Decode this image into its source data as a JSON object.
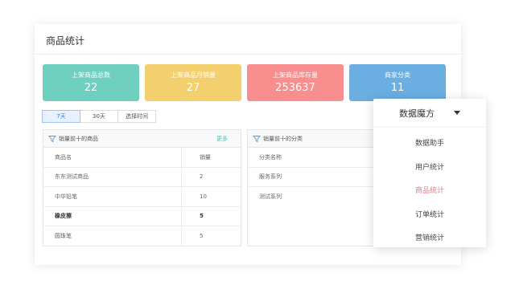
{
  "card": {
    "title": "商品统计"
  },
  "stats": [
    {
      "label": "上架商品总数",
      "value": "22",
      "color": "#6fd0c0"
    },
    {
      "label": "上架商品月销量",
      "value": "27",
      "color": "#f4cf6e"
    },
    {
      "label": "上架商品库存量",
      "value": "253637",
      "color": "#f88e8d"
    },
    {
      "label": "商家分类",
      "value": "11",
      "color": "#6aaee2"
    }
  ],
  "tabs": [
    "7天",
    "30天",
    "选择时间"
  ],
  "left_panel": {
    "title": "销量前十的商品",
    "more": "更多",
    "columns": [
      "商品名",
      "销量"
    ],
    "rows": [
      [
        "东东测试商品",
        "2"
      ],
      [
        "中华铅笔",
        "10"
      ],
      [
        "橡皮擦",
        "5"
      ],
      [
        "圆珠笔",
        "5"
      ]
    ]
  },
  "right_panel": {
    "title": "销量前十的分类",
    "columns": [
      "分类名称",
      ""
    ],
    "rows": [
      [
        "服务系列",
        ""
      ],
      [
        "测试系列",
        ""
      ]
    ]
  },
  "menu": {
    "title": "数据魔方",
    "items": [
      "数据助手",
      "用户统计",
      "商品统计",
      "订单统计",
      "营销统计"
    ],
    "active_index": 2,
    "active_color": "#f07a7a"
  },
  "icons": {
    "filter": "filter-icon",
    "caret": "caret-down-icon"
  }
}
